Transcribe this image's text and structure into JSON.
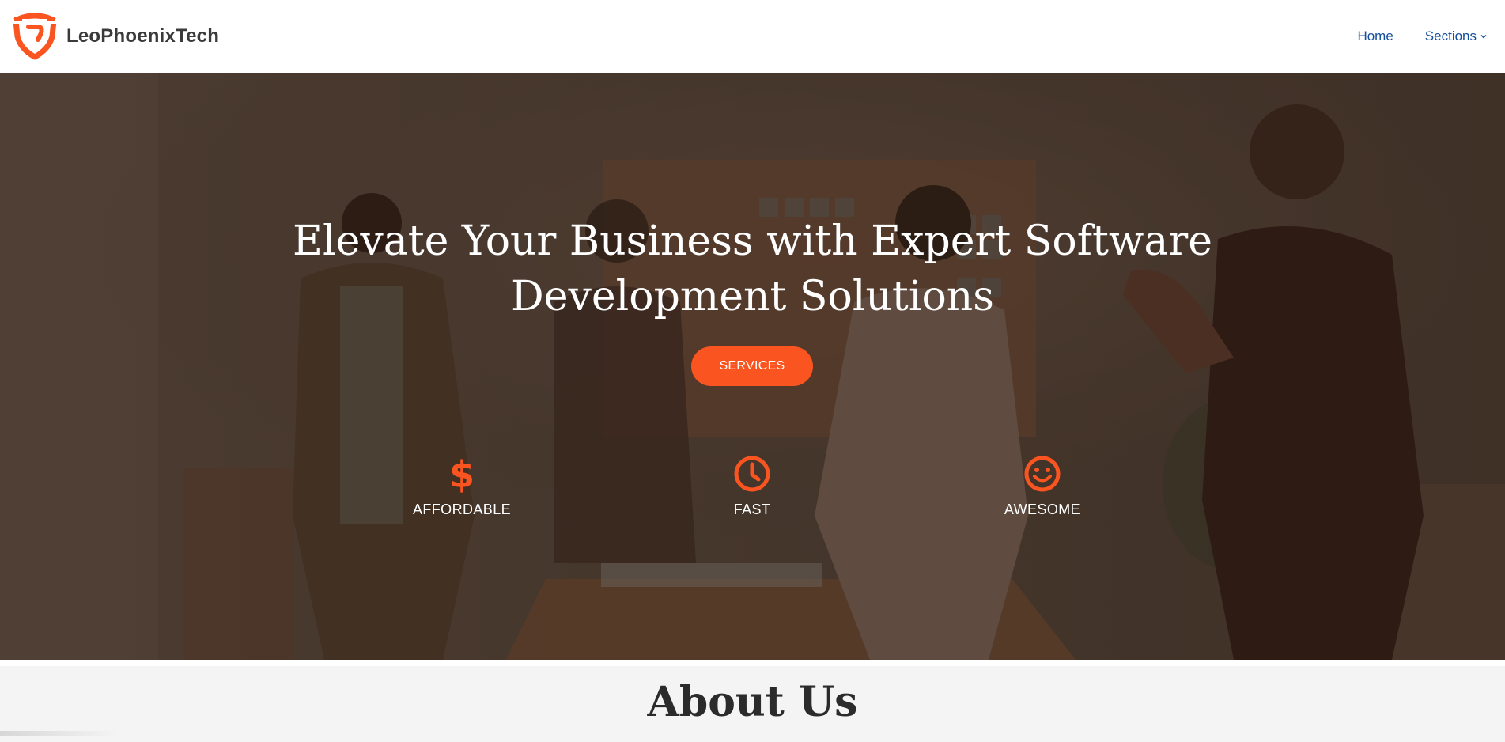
{
  "header": {
    "brand_name": "LeoPhoenixTech",
    "nav": [
      {
        "label": "Home"
      },
      {
        "label": "Sections",
        "has_dropdown": true
      }
    ]
  },
  "hero": {
    "title_line1": "Elevate Your Business with Expert Software",
    "title_line2": "Development Solutions",
    "cta_label": "SERVICES",
    "features": [
      {
        "icon": "dollar-icon",
        "label": "AFFORDABLE"
      },
      {
        "icon": "clock-icon",
        "label": "FAST"
      },
      {
        "icon": "smiley-icon",
        "label": "AWESOME"
      }
    ]
  },
  "about": {
    "title": "About Us"
  },
  "colors": {
    "accent": "#fa5420",
    "nav_link": "#16509a",
    "brand_text": "#3a3a3a",
    "about_bg": "#f4f4f4"
  }
}
